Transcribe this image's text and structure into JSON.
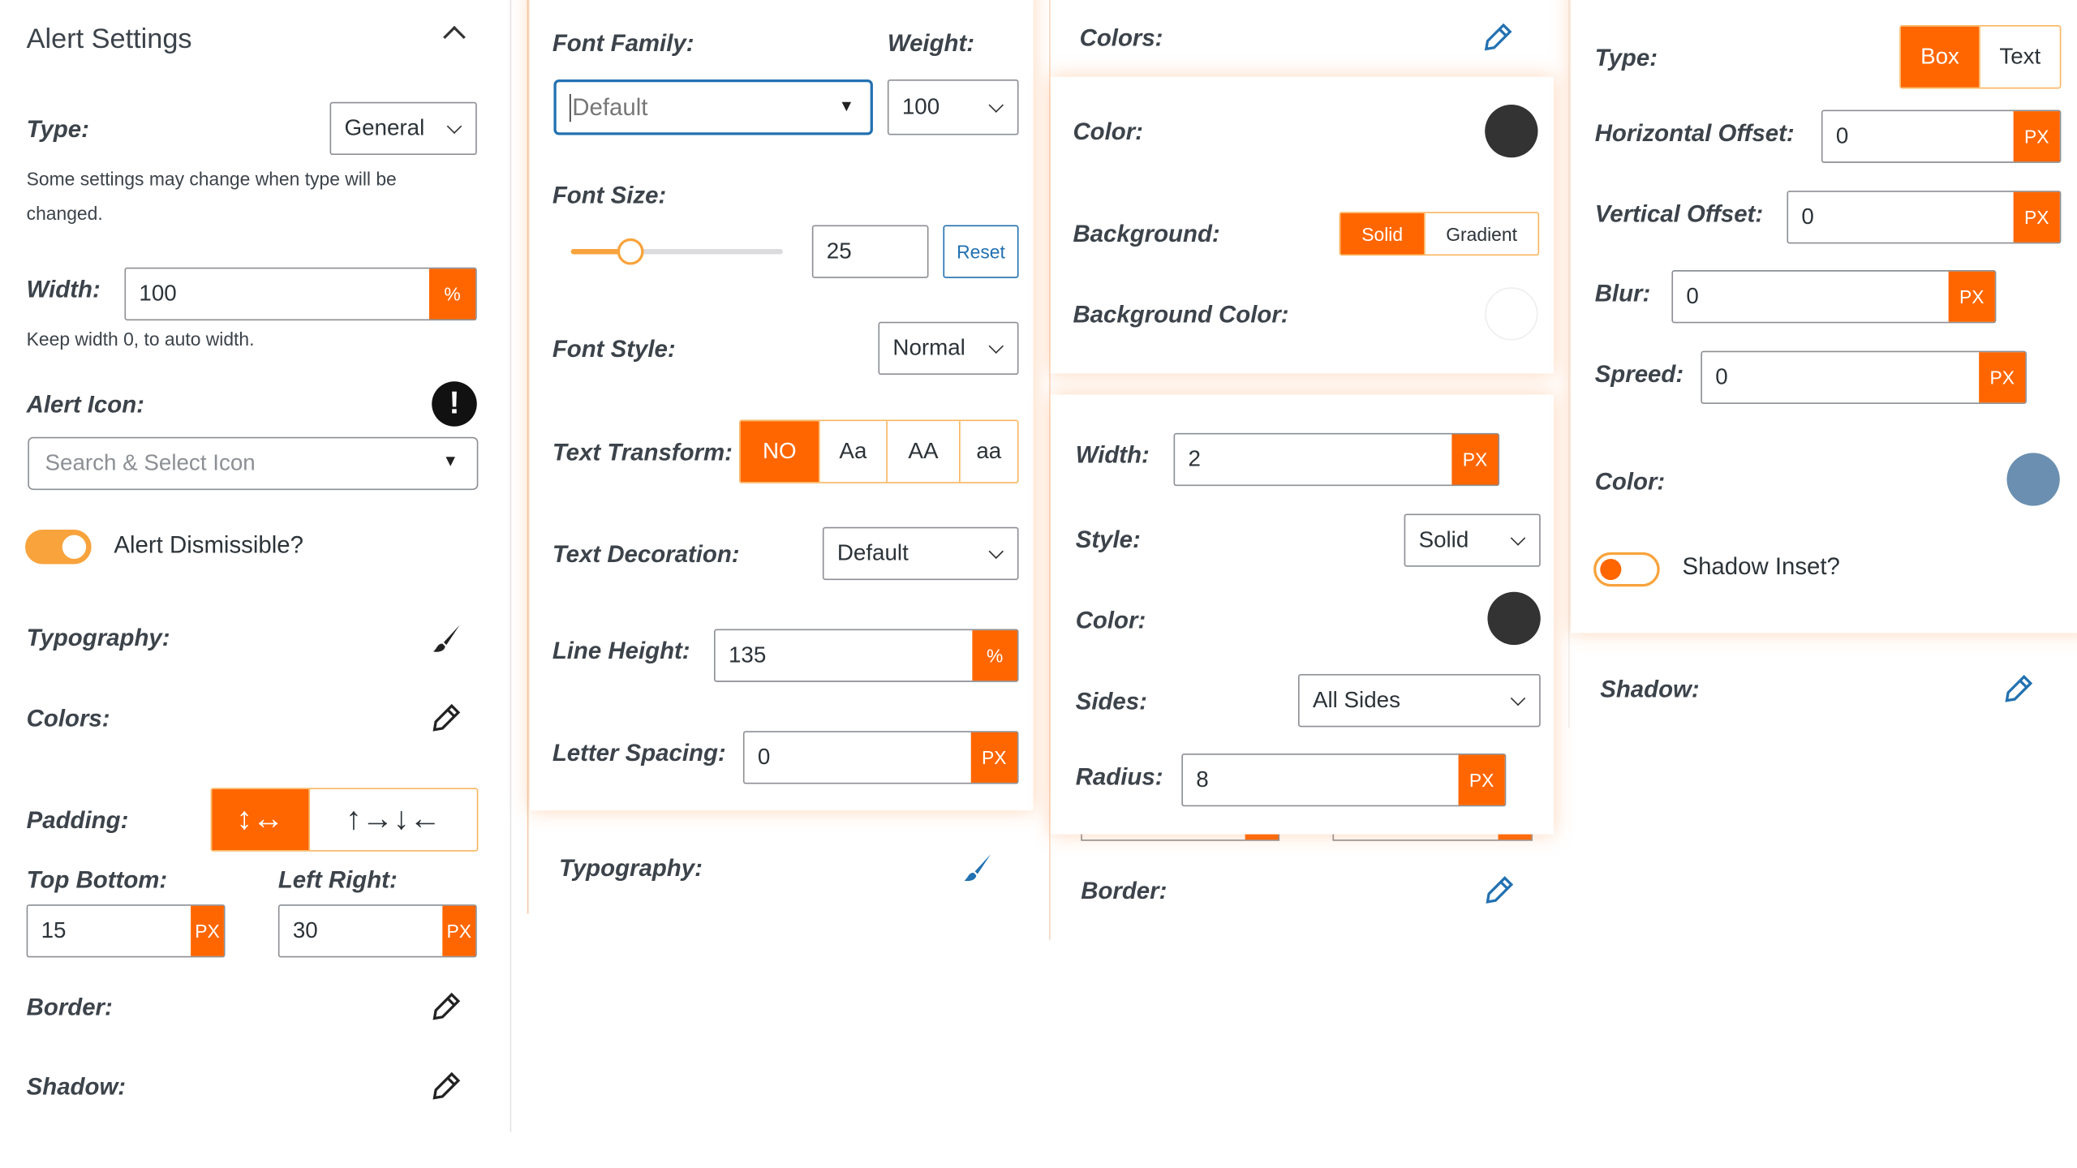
{
  "colors": {
    "accent": "#ff6600",
    "accent_light": "#f8b660",
    "focus_blue": "#2271b1",
    "text": "#3c434a"
  },
  "alert_settings": {
    "title": "Alert Settings",
    "type_label": "Type:",
    "type_value": "General",
    "type_help": "Some settings may change when type will be changed.",
    "width_label": "Width:",
    "width_value": "100",
    "width_unit": "%",
    "width_help": "Keep width 0, to auto width.",
    "alert_icon_label": "Alert Icon:",
    "alert_icon_placeholder": "Search & Select Icon",
    "dismissible_label": "Alert Dismissible?",
    "dismissible_on": true,
    "typography_label": "Typography:",
    "colors_label": "Colors:",
    "padding_label": "Padding:",
    "padding_modes": [
      "↕↔",
      "↑→↓←"
    ],
    "top_bottom_label": "Top Bottom:",
    "top_bottom_value": "15",
    "left_right_label": "Left Right:",
    "left_right_value": "30",
    "unit_px": "PX",
    "border_label": "Border:",
    "shadow_label": "Shadow:"
  },
  "typography": {
    "font_family_label": "Font Family:",
    "font_family_value": "Default",
    "weight_label": "Weight:",
    "weight_value": "100",
    "font_size_label": "Font Size:",
    "font_size_value": "25",
    "font_size_slider_fraction": 0.28,
    "reset_label": "Reset",
    "font_style_label": "Font Style:",
    "font_style_value": "Normal",
    "text_transform_label": "Text Transform:",
    "text_transform_options": [
      "NO",
      "Aa",
      "AA",
      "aa"
    ],
    "text_transform_selected": "NO",
    "text_decoration_label": "Text Decoration:",
    "text_decoration_value": "Default",
    "line_height_label": "Line Height:",
    "line_height_value": "135",
    "line_height_unit": "%",
    "letter_spacing_label": "Letter Spacing:",
    "letter_spacing_value": "0",
    "letter_spacing_unit": "PX",
    "footer_label": "Typography:"
  },
  "colors_panel": {
    "header_label": "Colors:",
    "color_label": "Color:",
    "color_value": "#333333",
    "background_label": "Background:",
    "background_options": [
      "Solid",
      "Gradient"
    ],
    "background_selected": "Solid",
    "background_color_label": "Background Color:",
    "background_color_value": "#ffffff"
  },
  "border_panel": {
    "width_label": "Width:",
    "width_value": "2",
    "width_unit": "PX",
    "style_label": "Style:",
    "style_value": "Solid",
    "color_label": "Color:",
    "color_value": "#333333",
    "sides_label": "Sides:",
    "sides_value": "All Sides",
    "radius_label": "Radius:",
    "radius_value": "8",
    "radius_unit": "PX",
    "footer_label": "Border:"
  },
  "shadow_panel": {
    "type_label": "Type:",
    "type_options": [
      "Box",
      "Text"
    ],
    "type_selected": "Box",
    "h_offset_label": "Horizontal Offset:",
    "h_offset_value": "0",
    "v_offset_label": "Vertical Offset:",
    "v_offset_value": "0",
    "blur_label": "Blur:",
    "blur_value": "0",
    "spread_label": "Spreed:",
    "spread_value": "0",
    "unit": "PX",
    "color_label": "Color:",
    "color_value": "#6a8fb0",
    "inset_label": "Shadow Inset?",
    "inset_on": false,
    "footer_label": "Shadow:"
  }
}
